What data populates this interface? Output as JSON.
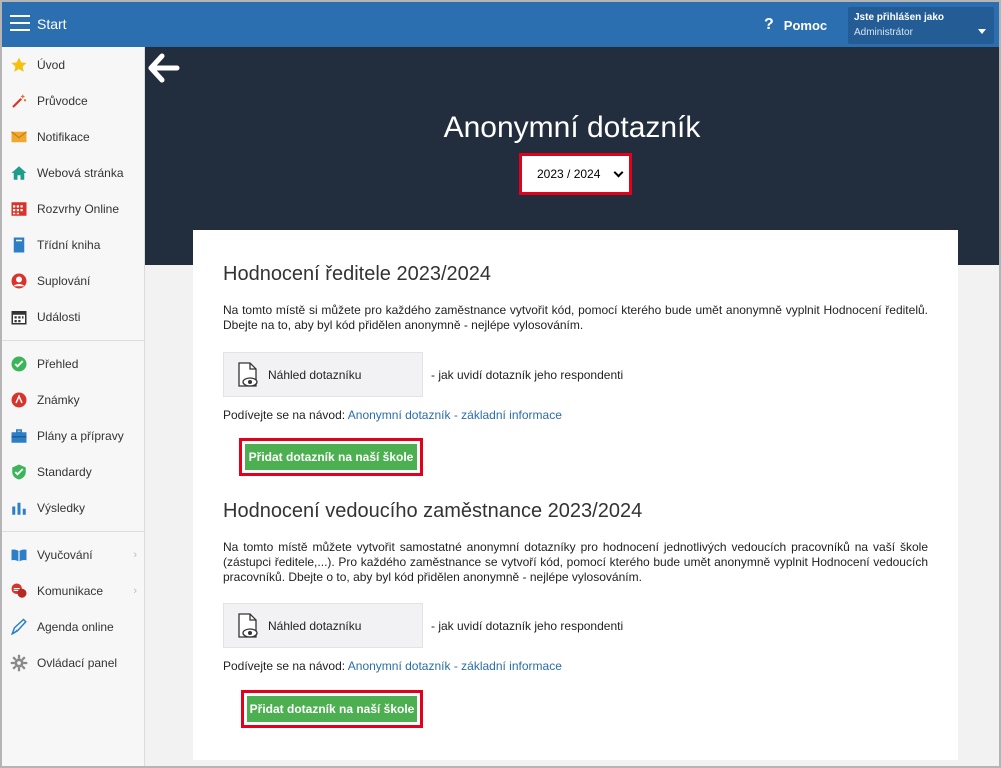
{
  "topbar": {
    "start_label": "Start",
    "help_label": "Pomoc",
    "user_top": "Jste přihlášen jako",
    "user_name": "Administrátor"
  },
  "sidebar": {
    "items": [
      {
        "label": "Úvod",
        "icon": "star-icon"
      },
      {
        "label": "Průvodce",
        "icon": "magic-wand-icon"
      },
      {
        "label": "Notifikace",
        "icon": "envelope-icon"
      },
      {
        "label": "Webová stránka",
        "icon": "home-icon"
      },
      {
        "label": "Rozvrhy Online",
        "icon": "calendar-grid-icon"
      },
      {
        "label": "Třídní kniha",
        "icon": "book-icon"
      },
      {
        "label": "Suplování",
        "icon": "user-icon"
      },
      {
        "label": "Události",
        "icon": "calendar-icon"
      },
      {
        "label": "Přehled",
        "icon": "check-circle-icon"
      },
      {
        "label": "Známky",
        "icon": "grade-icon"
      },
      {
        "label": "Plány a přípravy",
        "icon": "briefcase-icon"
      },
      {
        "label": "Standardy",
        "icon": "shield-check-icon"
      },
      {
        "label": "Výsledky",
        "icon": "bar-chart-icon"
      },
      {
        "label": "Vyučování",
        "icon": "open-book-icon"
      },
      {
        "label": "Komunikace",
        "icon": "chat-icon"
      },
      {
        "label": "Agenda online",
        "icon": "pen-icon"
      },
      {
        "label": "Ovládací panel",
        "icon": "gear-icon"
      }
    ]
  },
  "main": {
    "title": "Anonymní dotazník",
    "year_selected": "2023 / 2024",
    "sections": [
      {
        "title": "Hodnocení ředitele 2023/2024",
        "text": "Na tomto místě si můžete pro každého zaměstnance vytvořit kód, pomocí kterého bude umět anonymně vyplnit Hodnocení ředitelů. Dbejte na to, aby byl kód přidělen anonymně - nejlépe vylosováním.",
        "preview_label": "Náhled dotazníku",
        "preview_note": "- jak uvidí dotazník jeho respondenti",
        "guide_prefix": "Podívejte se na návod:",
        "guide_link": "Anonymní dotazník - základní informace",
        "add_label": "Přidat dotazník na naší škole"
      },
      {
        "title": "Hodnocení vedoucího zaměstnance 2023/2024",
        "text": "Na tomto místě můžete vytvořit samostatné anonymní dotazníky pro hodnocení jednotlivých vedoucích pracovníků na vaší škole (zástupci ředitele,...). Pro každého zaměstnance se vytvoří kód, pomocí kterého bude umět anonymně vyplnit Hodnocení vedoucích pracovníků. Dbejte o to, aby byl kód přidělen anonymně - nejlépe vylosováním.",
        "preview_label": "Náhled dotazníku",
        "preview_note": "- jak uvidí dotazník jeho respondenti",
        "guide_prefix": "Podívejte se na návod:",
        "guide_link": "Anonymní dotazník - základní informace",
        "add_label": "Přidat dotazník na naší škole"
      }
    ]
  },
  "colors": {
    "topbar": "#2c6fb0",
    "header_dark": "#222e3d",
    "highlight": "#e3001b",
    "button_green": "#4caf50",
    "link": "#2a6ea8"
  }
}
